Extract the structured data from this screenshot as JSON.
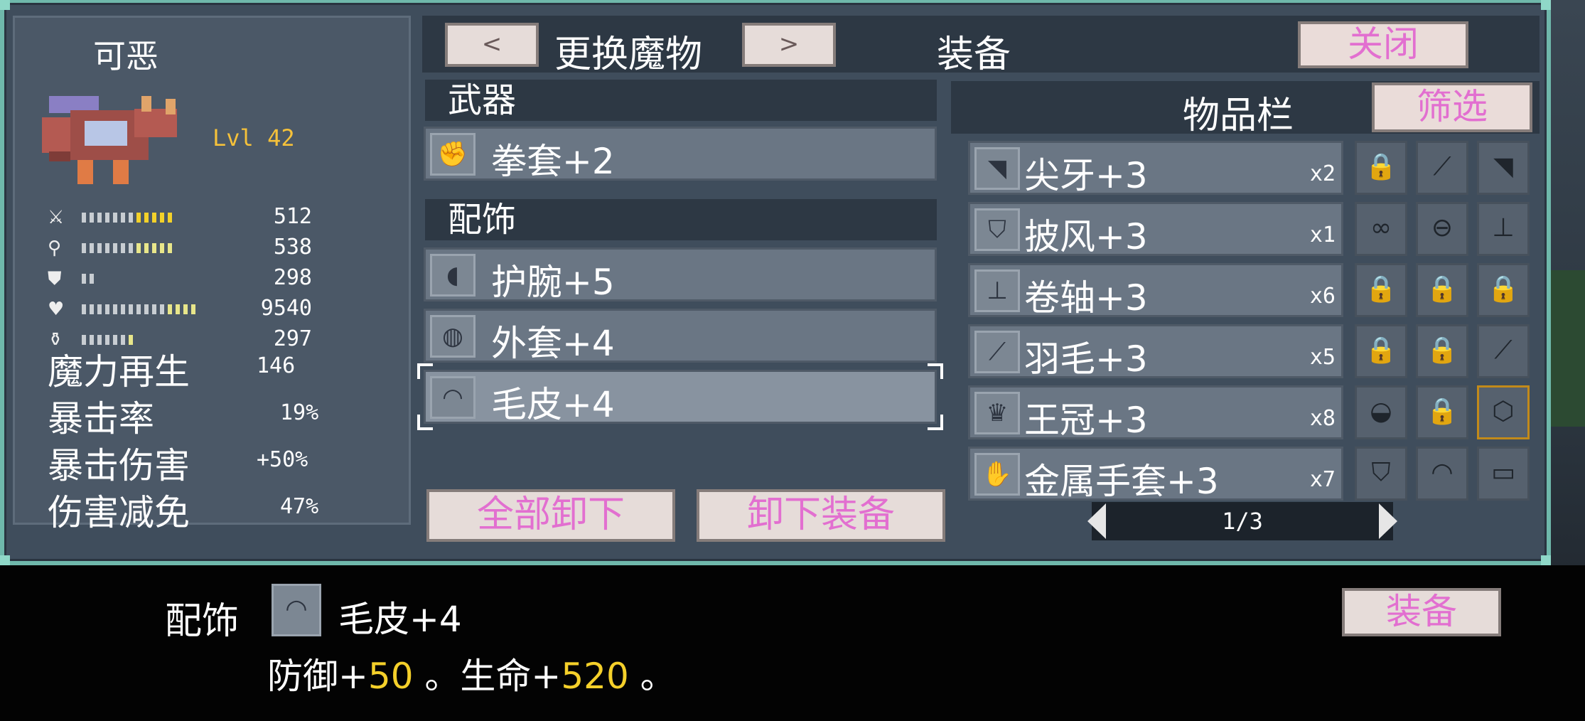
{
  "monster": {
    "name": "可恶",
    "level": "Lvl 42",
    "stats": [
      {
        "icon": "sword-icon",
        "value": "512",
        "white": 7,
        "yellow": 5,
        "ytype": "y"
      },
      {
        "icon": "wand-icon",
        "value": "538",
        "white": 7,
        "yellow": 5,
        "ytype": "ly"
      },
      {
        "icon": "shield-icon",
        "value": "298",
        "white": 2,
        "yellow": 0,
        "ytype": "y"
      },
      {
        "icon": "heart-icon",
        "value": "9540",
        "white": 11,
        "yellow": 4,
        "ytype": "ly"
      },
      {
        "icon": "potion-icon",
        "value": "297",
        "white": 6,
        "yellow": 1,
        "ytype": "ly"
      }
    ],
    "attributes": [
      {
        "label": "魔力再生",
        "value": "146"
      },
      {
        "label": "暴击率",
        "value": "19%"
      },
      {
        "label": "暴击伤害",
        "value": "+50%"
      },
      {
        "label": "伤害减免",
        "value": "47%"
      }
    ]
  },
  "header": {
    "prev_label": "<",
    "switch_label": "更换魔物",
    "next_label": ">",
    "equip_title": "装备",
    "close_label": "关闭"
  },
  "equipment": {
    "weapon_heading": "武器",
    "weapon": {
      "label": "拳套+2",
      "icon": "fist-icon",
      "glyph": "✊"
    },
    "accessory_heading": "配饰",
    "accessories": [
      {
        "label": "护腕+5",
        "icon": "bracer-icon",
        "glyph": "◖"
      },
      {
        "label": "外套+4",
        "icon": "coat-icon",
        "glyph": "◍"
      },
      {
        "label": "毛皮+4",
        "icon": "fur-icon",
        "glyph": "◠"
      }
    ],
    "unequip_all_label": "全部卸下",
    "unequip_label": "卸下装备"
  },
  "inventory": {
    "title": "物品栏",
    "filter_label": "筛选",
    "items": [
      {
        "label": "尖牙+3",
        "qty": "x2",
        "icon": "fang-icon",
        "glyph": "◥",
        "slots": [
          {
            "icon": "locked-icon",
            "glyph": "🔒"
          },
          {
            "icon": "feather-icon",
            "glyph": "⟋"
          },
          {
            "icon": "fang-icon",
            "glyph": "◥"
          }
        ]
      },
      {
        "label": "披风+3",
        "qty": "x1",
        "icon": "cloak-icon",
        "glyph": "⛉",
        "slots": [
          {
            "icon": "bracelet-icon",
            "glyph": "∞"
          },
          {
            "icon": "belt-icon",
            "glyph": "⊖"
          },
          {
            "icon": "scroll-icon",
            "glyph": "⊥"
          }
        ]
      },
      {
        "label": "卷轴+3",
        "qty": "x6",
        "icon": "scroll-icon",
        "glyph": "⊥",
        "slots": [
          {
            "icon": "locked-icon",
            "glyph": "🔒"
          },
          {
            "icon": "locked-icon",
            "glyph": "🔒"
          },
          {
            "icon": "locked-icon",
            "glyph": "🔒"
          }
        ]
      },
      {
        "label": "羽毛+3",
        "qty": "x5",
        "icon": "feather-icon",
        "glyph": "⟋",
        "slots": [
          {
            "icon": "locked-icon",
            "glyph": "🔒"
          },
          {
            "icon": "locked-icon",
            "glyph": "🔒"
          },
          {
            "icon": "feather-icon",
            "glyph": "⟋"
          }
        ]
      },
      {
        "label": "王冠+3",
        "qty": "x8",
        "icon": "crown-icon",
        "glyph": "♛",
        "slots": [
          {
            "icon": "shell-icon",
            "glyph": "◒"
          },
          {
            "icon": "locked-icon",
            "glyph": "🔒"
          },
          {
            "icon": "cube-icon",
            "glyph": "⬡",
            "highlight": true
          }
        ]
      },
      {
        "label": "金属手套+3",
        "qty": "x7",
        "icon": "gauntlet-icon",
        "glyph": "✋",
        "slots": [
          {
            "icon": "cloak-icon",
            "glyph": "⛉"
          },
          {
            "icon": "fur-icon",
            "glyph": "◠"
          },
          {
            "icon": "book-icon",
            "glyph": "▭"
          }
        ]
      }
    ],
    "page": "1/3"
  },
  "description": {
    "category": "配饰",
    "icon": "fur-icon",
    "glyph": "◠",
    "name": "毛皮+4",
    "effect_def_label": "防御+",
    "effect_def_value": "50",
    "effect_sep": " 。生命+",
    "effect_hp_value": "520",
    "effect_end": " 。",
    "equip_label": "装备"
  },
  "colors": {
    "accent_pink": "#e26fd0",
    "level_gold": "#f5c13a",
    "frame_teal": "#6fb8ab",
    "value_yellow": "#f5d02a"
  }
}
